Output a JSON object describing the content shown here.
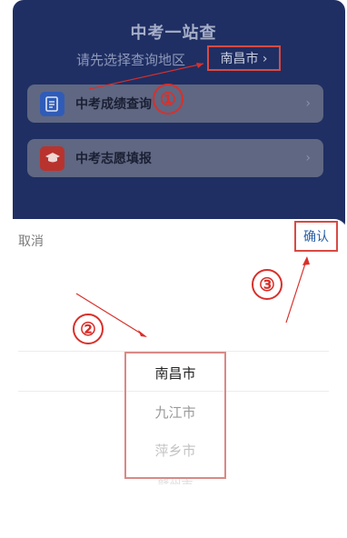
{
  "header": {
    "title": "中考一站查",
    "subtitle": "请先选择查询地区",
    "region_button": "南昌市 ›"
  },
  "menu": [
    {
      "label": "中考成绩查询",
      "icon": "document-icon",
      "icon_color": "#2f5cb8"
    },
    {
      "label": "中考志愿填报",
      "icon": "graduation-cap-icon",
      "icon_color": "#c8322d"
    }
  ],
  "sheet": {
    "cancel": "取消",
    "confirm": "确认",
    "options": [
      "南昌市",
      "九江市",
      "萍乡市",
      "赣州市"
    ],
    "selected": "南昌市"
  },
  "annotations": [
    "①",
    "②",
    "③"
  ],
  "colors": {
    "annotation": "#d8302b",
    "panel": "#1f2f63",
    "confirm_text": "#2a5fa8"
  }
}
